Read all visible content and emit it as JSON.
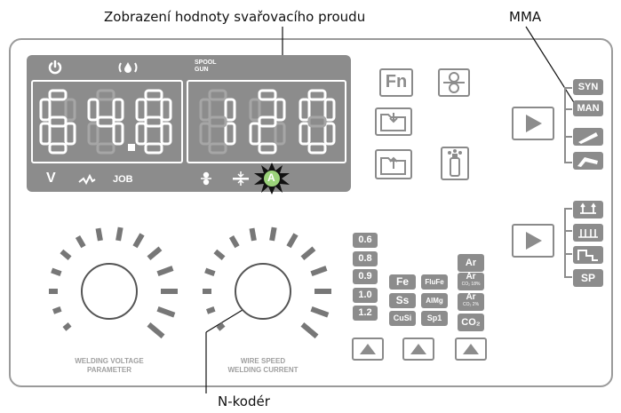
{
  "annotations": {
    "current_display": "Zobrazení hodnoty svařovacího proudu",
    "mode_label": "MMA",
    "encoder": "N-kodér"
  },
  "display": {
    "left_value": "64.8",
    "right_value": "120",
    "spool_gun_line1": "SPOOL",
    "spool_gun_line2": "GUN",
    "unit_v": "V",
    "job_label": "JOB",
    "unit_a": "A",
    "colors": {
      "panel": "#8c8c8c",
      "lit_segment": "#ffffff",
      "dim_segment": "#a6a6a6",
      "amp_badge": "#9bd37a"
    }
  },
  "buttons": {
    "fn_label": "Fn"
  },
  "modes": [
    "SYN",
    "MAN"
  ],
  "trigger_modes": [
    "SP"
  ],
  "wire_diameters": [
    "0.6",
    "0.8",
    "0.9",
    "1.0",
    "1.2"
  ],
  "materials": [
    "Fe",
    "Ss",
    "CuSi"
  ],
  "materials2": [
    "FluFe",
    "AlMg",
    "Sp1"
  ],
  "gases": [
    {
      "main": "Ar",
      "sub": ""
    },
    {
      "main": "Ar",
      "sub": "CO₂ 18%"
    },
    {
      "main": "Ar",
      "sub": "CO₂ 2%"
    },
    {
      "main": "CO₂",
      "sub": ""
    }
  ],
  "knobs": {
    "left_line1": "WELDING VOLTAGE",
    "left_line2": "PARAMETER",
    "right_line1": "WIRE SPEED",
    "right_line2": "WELDING CURRENT"
  }
}
